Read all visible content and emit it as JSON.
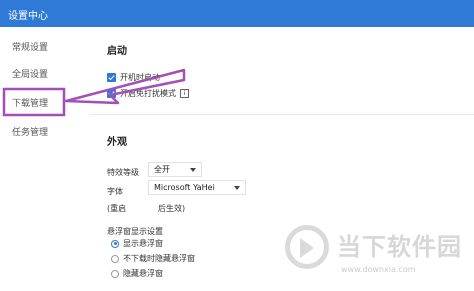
{
  "window": {
    "title": "设置中心"
  },
  "sidebar": {
    "items": [
      {
        "label": "常规设置"
      },
      {
        "label": "全局设置"
      },
      {
        "label": "下载管理"
      },
      {
        "label": "任务管理"
      }
    ]
  },
  "startup": {
    "title": "启动",
    "options": [
      {
        "label": "开机时启动",
        "checked": true
      },
      {
        "label": "开启免打扰模式",
        "checked": true
      }
    ]
  },
  "appearance": {
    "title": "外观",
    "effect_label": "特效等级",
    "effect_value": "全开",
    "font_label": "字体",
    "font_value": "Microsoft YaHei",
    "restart_note_a": "(重启",
    "restart_note_b": "后生效)",
    "float_title": "悬浮窗显示设置",
    "float_options": [
      {
        "label": "显示悬浮窗",
        "selected": true
      },
      {
        "label": "不下载时隐藏悬浮窗",
        "selected": false
      },
      {
        "label": "隐藏悬浮窗",
        "selected": false
      }
    ]
  },
  "watermark": {
    "title": "当下软件园",
    "url": "www.downxia.com"
  },
  "colors": {
    "titlebar": "#2e7ad6",
    "annotation": "#a44fb8"
  }
}
